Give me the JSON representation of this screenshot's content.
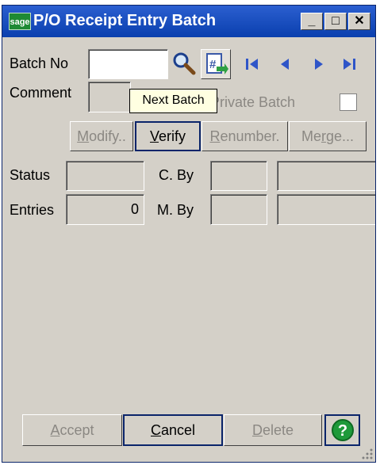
{
  "window": {
    "logo": "sage",
    "title": "P/O Receipt Entry Batch",
    "min_label": "_",
    "max_label": "□",
    "close_label": "✕"
  },
  "form": {
    "batch_no_label": "Batch No",
    "batch_no_value": "",
    "comment_label": "Comment",
    "comment_value": "",
    "private_batch_label": "Private Batch",
    "status_label": "Status",
    "status_value": "",
    "entries_label": "Entries",
    "entries_value": "0",
    "c_by_label": "C. By",
    "m_by_label": "M. By"
  },
  "tooltip": {
    "text": "Next Batch"
  },
  "buttons": {
    "modify_pre": "M",
    "modify_rest": "odify..",
    "verify_pre": "V",
    "verify_rest": "erify",
    "renumber_pre": "R",
    "renumber_rest": "enumber.",
    "merge_pre": "Me",
    "merge_u": "r",
    "merge_rest": "ge...",
    "accept_pre": "A",
    "accept_rest": "ccept",
    "cancel_pre": "C",
    "cancel_rest": "ancel",
    "delete_pre": "D",
    "delete_rest": "elete"
  },
  "icons": [
    "search-icon",
    "batch-lookup-icon",
    "first-icon",
    "previous-icon",
    "next-icon",
    "last-icon",
    "help-icon"
  ],
  "colors": {
    "titlebar": "#0a3fae",
    "panel": "#d4d0c8",
    "help": "#1e9a3a",
    "tooltip": "#ffffe1"
  }
}
